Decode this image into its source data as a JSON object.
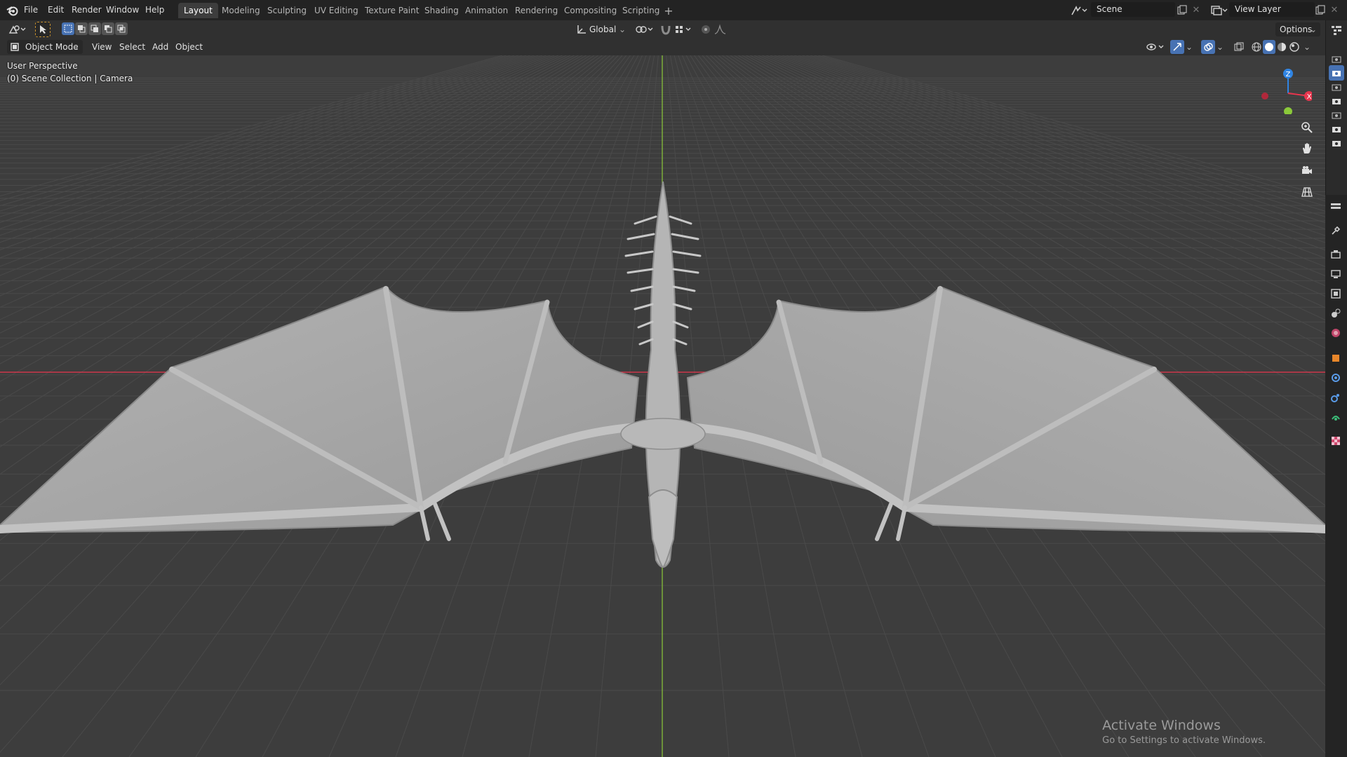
{
  "app": {
    "logo": "blender-logo-icon"
  },
  "menu": [
    "File",
    "Edit",
    "Render",
    "Window",
    "Help"
  ],
  "workspaces": [
    "Layout",
    "Modeling",
    "Sculpting",
    "UV Editing",
    "Texture Paint",
    "Shading",
    "Animation",
    "Rendering",
    "Compositing",
    "Scripting"
  ],
  "active_workspace": "Layout",
  "scene": {
    "name": "Scene",
    "view_layer": "View Layer"
  },
  "header": {
    "orientation": "Global",
    "options_label": "Options",
    "mode": "Object Mode",
    "menus": [
      "View",
      "Select",
      "Add",
      "Object"
    ]
  },
  "viewport": {
    "perspective_label": "User Perspective",
    "collection_label": "(0) Scene Collection | Camera",
    "gizmo": {
      "z": "Z",
      "x": "X"
    }
  },
  "colors": {
    "accent": "#4772b3",
    "x_axis": "#e8364e",
    "y_axis": "#8bc93a",
    "z_axis": "#2f84e3",
    "model": "#a7a7a7"
  },
  "watermark": {
    "title": "Activate Windows",
    "subtitle": "Go to Settings to activate Windows."
  }
}
